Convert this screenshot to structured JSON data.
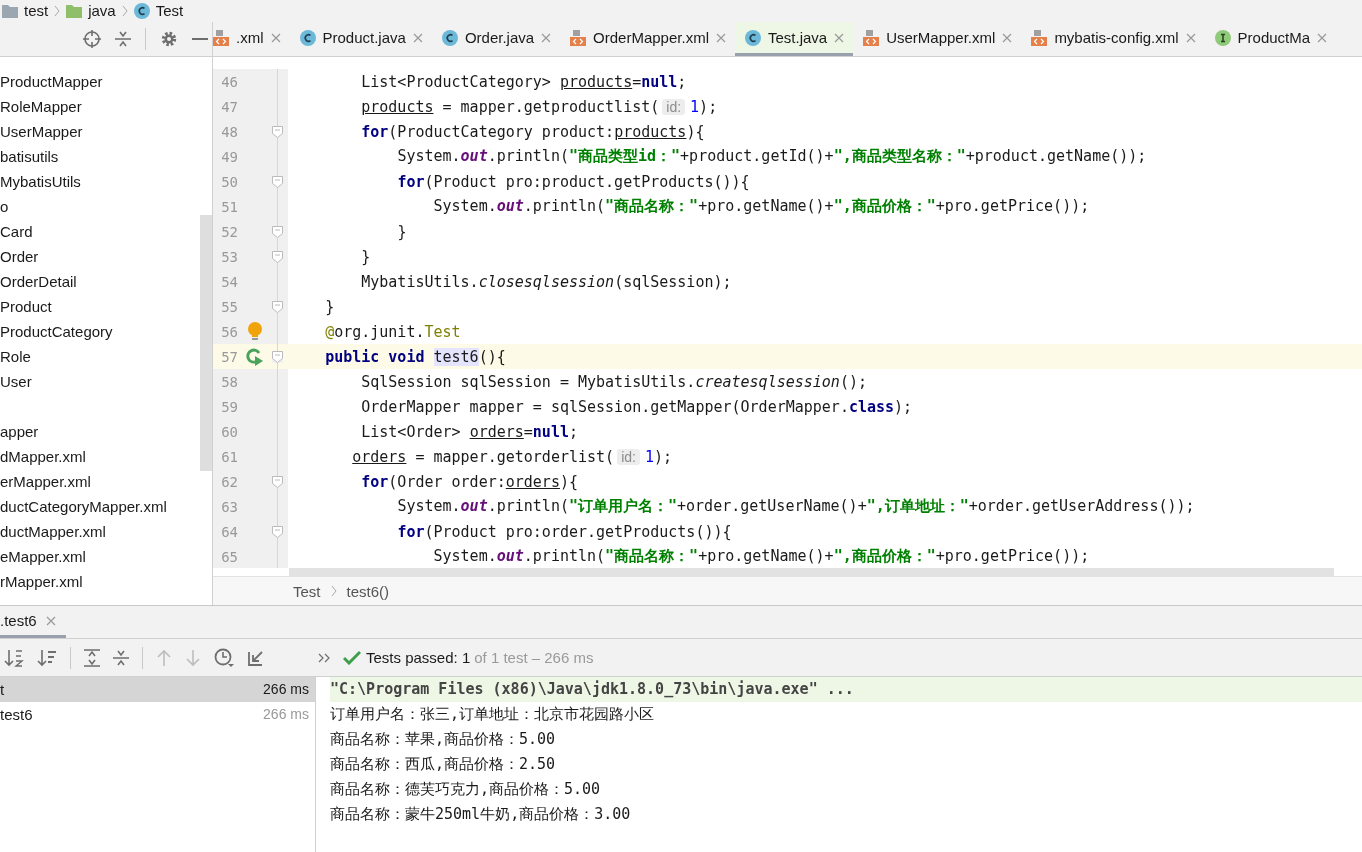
{
  "breadcrumb": [
    {
      "kind": "folder",
      "label": "test"
    },
    {
      "kind": "source-folder",
      "label": "java"
    },
    {
      "kind": "class",
      "label": "Test"
    }
  ],
  "project_tree": {
    "sections": [
      {
        "items": [
          "ProductMapper",
          "RoleMapper",
          "UserMapper",
          "batisutils",
          "MybatisUtils",
          "o",
          "Card",
          "Order",
          "OrderDetail",
          "Product",
          "ProductCategory",
          "Role",
          "User"
        ]
      },
      {
        "items": [
          "apper",
          "dMapper.xml",
          "erMapper.xml",
          "ductCategoryMapper.xml",
          "ductMapper.xml",
          "eMapper.xml",
          "rMapper.xml"
        ]
      }
    ]
  },
  "editor": {
    "tabs": [
      {
        "kind": "xml",
        "label": ".xml",
        "selected": false
      },
      {
        "kind": "class",
        "label": "Product.java",
        "selected": false
      },
      {
        "kind": "class",
        "label": "Order.java",
        "selected": false
      },
      {
        "kind": "xml",
        "label": "OrderMapper.xml",
        "selected": false
      },
      {
        "kind": "class",
        "label": "Test.java",
        "selected": true
      },
      {
        "kind": "xml",
        "label": "UserMapper.xml",
        "selected": false
      },
      {
        "kind": "xml",
        "label": "mybatis-config.xml",
        "selected": false
      },
      {
        "kind": "interface",
        "label": "ProductMa",
        "selected": false
      }
    ],
    "lines": [
      {
        "number": "46",
        "kind": "plain",
        "current": false,
        "fold": false,
        "tokens": [
          {
            "kind": "plain",
            "text": "        List<ProductCategory> "
          },
          {
            "kind": "var",
            "text": "products"
          },
          {
            "kind": "plain",
            "text": "="
          },
          {
            "kind": "keyword",
            "text": "null"
          },
          {
            "kind": "plain",
            "text": ";"
          }
        ]
      },
      {
        "number": "47",
        "kind": "plain",
        "current": false,
        "fold": false,
        "tokens": [
          {
            "kind": "var",
            "text": "        products"
          },
          {
            "kind": "plain",
            "text": " = mapper.getproductlist("
          },
          {
            "kind": "hint",
            "text": "id:"
          },
          {
            "kind": "number",
            "text": "1"
          },
          {
            "kind": "plain",
            "text": ");"
          }
        ]
      },
      {
        "number": "48",
        "kind": "plain",
        "current": false,
        "fold": true,
        "tokens": [
          {
            "kind": "keyword",
            "text": "        for"
          },
          {
            "kind": "plain",
            "text": "(ProductCategory product:"
          },
          {
            "kind": "var",
            "text": "products"
          },
          {
            "kind": "plain",
            "text": "){"
          }
        ]
      },
      {
        "number": "49",
        "kind": "plain",
        "current": false,
        "fold": false,
        "tokens": [
          {
            "kind": "plain",
            "text": "            System."
          },
          {
            "kind": "field",
            "text": "out"
          },
          {
            "kind": "plain",
            "text": ".println("
          },
          {
            "kind": "string",
            "text": "\"商品类型id：\""
          },
          {
            "kind": "plain",
            "text": "+product.getId()+"
          },
          {
            "kind": "string",
            "text": "\",商品类型名称：\""
          },
          {
            "kind": "plain",
            "text": "+product.getName());"
          }
        ]
      },
      {
        "number": "50",
        "kind": "plain",
        "current": false,
        "fold": true,
        "tokens": [
          {
            "kind": "keyword",
            "text": "            for"
          },
          {
            "kind": "plain",
            "text": "(Product pro:product.getProducts()){"
          }
        ]
      },
      {
        "number": "51",
        "kind": "plain",
        "current": false,
        "fold": false,
        "tokens": [
          {
            "kind": "plain",
            "text": "                System."
          },
          {
            "kind": "field",
            "text": "out"
          },
          {
            "kind": "plain",
            "text": ".println("
          },
          {
            "kind": "string",
            "text": "\"商品名称：\""
          },
          {
            "kind": "plain",
            "text": "+pro.getName()+"
          },
          {
            "kind": "string",
            "text": "\",商品价格：\""
          },
          {
            "kind": "plain",
            "text": "+pro.getPrice());"
          }
        ]
      },
      {
        "number": "52",
        "kind": "plain",
        "current": false,
        "fold": true,
        "tokens": [
          {
            "kind": "plain",
            "text": "            }"
          }
        ]
      },
      {
        "number": "53",
        "kind": "plain",
        "current": false,
        "fold": true,
        "tokens": [
          {
            "kind": "plain",
            "text": "        }"
          }
        ]
      },
      {
        "number": "54",
        "kind": "plain",
        "current": false,
        "fold": false,
        "tokens": [
          {
            "kind": "plain",
            "text": "        MybatisUtils."
          },
          {
            "kind": "static",
            "text": "closesqlsession"
          },
          {
            "kind": "plain",
            "text": "(sqlSession);"
          }
        ]
      },
      {
        "number": "55",
        "kind": "plain",
        "current": false,
        "fold": true,
        "tokens": [
          {
            "kind": "plain",
            "text": "    }"
          }
        ]
      },
      {
        "number": "56",
        "kind": "bulb",
        "current": false,
        "fold": false,
        "tokens": [
          {
            "kind": "annotation",
            "text": "    @"
          },
          {
            "kind": "plain",
            "text": "org.junit."
          },
          {
            "kind": "annotation",
            "text": "Test"
          }
        ]
      },
      {
        "number": "57",
        "kind": "run",
        "current": true,
        "fold": true,
        "tokens": [
          {
            "kind": "keyword",
            "text": "    public void "
          },
          {
            "kind": "mark",
            "text": "test6"
          },
          {
            "kind": "plain",
            "text": "(){"
          }
        ]
      },
      {
        "number": "58",
        "kind": "plain",
        "current": false,
        "fold": false,
        "tokens": [
          {
            "kind": "plain",
            "text": "        SqlSession sqlSession = MybatisUtils."
          },
          {
            "kind": "static",
            "text": "createsqlsession"
          },
          {
            "kind": "plain",
            "text": "();"
          }
        ]
      },
      {
        "number": "59",
        "kind": "plain",
        "current": false,
        "fold": false,
        "tokens": [
          {
            "kind": "plain",
            "text": "        OrderMapper mapper = sqlSession.getMapper(OrderMapper."
          },
          {
            "kind": "keyword",
            "text": "class"
          },
          {
            "kind": "plain",
            "text": ");"
          }
        ]
      },
      {
        "number": "60",
        "kind": "plain",
        "current": false,
        "fold": false,
        "tokens": [
          {
            "kind": "plain",
            "text": "        List<Order> "
          },
          {
            "kind": "var",
            "text": "orders"
          },
          {
            "kind": "plain",
            "text": "="
          },
          {
            "kind": "keyword",
            "text": "null"
          },
          {
            "kind": "plain",
            "text": ";"
          }
        ]
      },
      {
        "number": "61",
        "kind": "plain",
        "current": false,
        "fold": false,
        "tokens": [
          {
            "kind": "var",
            "text": "       orders"
          },
          {
            "kind": "plain",
            "text": " = mapper.getorderlist("
          },
          {
            "kind": "hint",
            "text": "id:"
          },
          {
            "kind": "number",
            "text": "1"
          },
          {
            "kind": "plain",
            "text": ");"
          }
        ]
      },
      {
        "number": "62",
        "kind": "plain",
        "current": false,
        "fold": true,
        "tokens": [
          {
            "kind": "keyword",
            "text": "        for"
          },
          {
            "kind": "plain",
            "text": "(Order order:"
          },
          {
            "kind": "var",
            "text": "orders"
          },
          {
            "kind": "plain",
            "text": "){"
          }
        ]
      },
      {
        "number": "63",
        "kind": "plain",
        "current": false,
        "fold": false,
        "tokens": [
          {
            "kind": "plain",
            "text": "            System."
          },
          {
            "kind": "field",
            "text": "out"
          },
          {
            "kind": "plain",
            "text": ".println("
          },
          {
            "kind": "string",
            "text": "\"订单用户名：\""
          },
          {
            "kind": "plain",
            "text": "+order.getUserName()+"
          },
          {
            "kind": "string",
            "text": "\",订单地址：\""
          },
          {
            "kind": "plain",
            "text": "+order.getUserAddress());"
          }
        ]
      },
      {
        "number": "64",
        "kind": "plain",
        "current": false,
        "fold": true,
        "tokens": [
          {
            "kind": "keyword",
            "text": "            for"
          },
          {
            "kind": "plain",
            "text": "(Product pro:order.getProducts()){"
          }
        ]
      },
      {
        "number": "65",
        "kind": "plain",
        "current": false,
        "fold": false,
        "tokens": [
          {
            "kind": "plain",
            "text": "                System."
          },
          {
            "kind": "field",
            "text": "out"
          },
          {
            "kind": "plain",
            "text": ".println("
          },
          {
            "kind": "string",
            "text": "\"商品名称：\""
          },
          {
            "kind": "plain",
            "text": "+pro.getName()+"
          },
          {
            "kind": "string",
            "text": "\",商品价格：\""
          },
          {
            "kind": "plain",
            "text": "+pro.getPrice());"
          }
        ]
      }
    ],
    "breadcrumb": [
      "Test",
      "test6()"
    ]
  },
  "run_panel": {
    "tab": {
      "label": ".test6",
      "selected": true
    },
    "status": {
      "passed": "Tests passed: 1",
      "detail": "of 1 test – 266 ms"
    },
    "tests": [
      {
        "label": "t",
        "time": "266 ms",
        "selected": true
      },
      {
        "label": "test6",
        "time": "266 ms",
        "selected": false
      }
    ],
    "console": [
      {
        "kind": "command",
        "text": "\"C:\\Program Files (x86)\\Java\\jdk1.8.0_73\\bin\\java.exe\" ..."
      },
      {
        "kind": "output",
        "text": "订单用户名：张三,订单地址：北京市花园路小区"
      },
      {
        "kind": "output",
        "text": "商品名称：苹果,商品价格：5.00"
      },
      {
        "kind": "output",
        "text": "商品名称：西瓜,商品价格：2.50"
      },
      {
        "kind": "output",
        "text": "商品名称：德芙巧克力,商品价格：5.00"
      },
      {
        "kind": "output",
        "text": "商品名称：蒙牛250ml牛奶,商品价格：3.00"
      }
    ]
  }
}
